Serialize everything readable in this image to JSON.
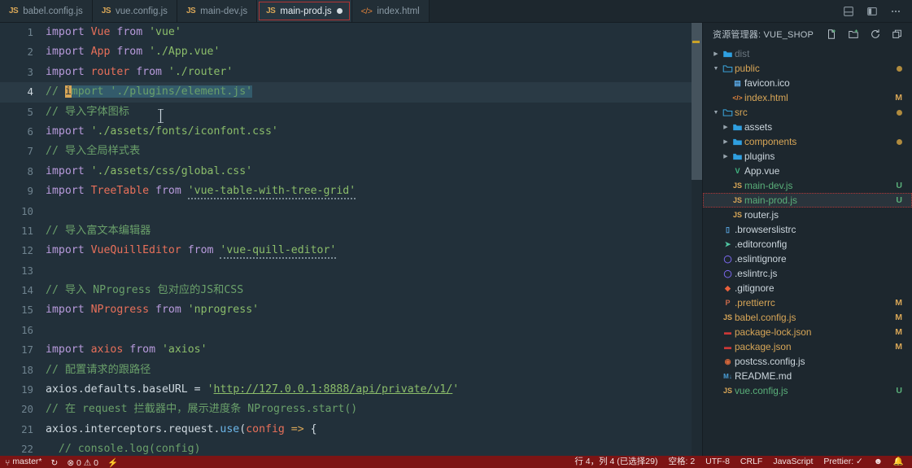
{
  "window": {
    "title": "main-prod.js — vue_shop — Visual Studio Code"
  },
  "tabbar": {
    "tabs": [
      {
        "label": "babel.config.js",
        "icon": "js-file-icon",
        "icon_text": "JS",
        "active": false,
        "dirty": false
      },
      {
        "label": "vue.config.js",
        "icon": "js-file-icon",
        "icon_text": "JS",
        "active": false,
        "dirty": false
      },
      {
        "label": "main-dev.js",
        "icon": "js-file-icon",
        "icon_text": "JS",
        "active": false,
        "dirty": false
      },
      {
        "label": "main-prod.js",
        "icon": "js-file-icon",
        "icon_text": "JS",
        "active": true,
        "dirty": true
      },
      {
        "label": "index.html",
        "icon": "html-file-icon",
        "icon_text": "</>",
        "active": false,
        "dirty": false
      }
    ],
    "actions": [
      {
        "name": "split-editor-down-icon",
        "glyph": "⫟"
      },
      {
        "name": "split-editor-right-icon",
        "glyph": "▥"
      },
      {
        "name": "more-actions-icon",
        "glyph": "···"
      }
    ]
  },
  "editor": {
    "language": "JavaScript",
    "active_line": 4,
    "lines": [
      {
        "n": 1,
        "tokens": [
          {
            "t": "import",
            "c": "kw"
          },
          {
            "t": " ",
            "c": "plain"
          },
          {
            "t": "Vue",
            "c": "id"
          },
          {
            "t": " ",
            "c": "plain"
          },
          {
            "t": "from",
            "c": "kw"
          },
          {
            "t": " ",
            "c": "plain"
          },
          {
            "t": "'vue'",
            "c": "str"
          }
        ]
      },
      {
        "n": 2,
        "tokens": [
          {
            "t": "import",
            "c": "kw"
          },
          {
            "t": " ",
            "c": "plain"
          },
          {
            "t": "App",
            "c": "id"
          },
          {
            "t": " ",
            "c": "plain"
          },
          {
            "t": "from",
            "c": "kw"
          },
          {
            "t": " ",
            "c": "plain"
          },
          {
            "t": "'./App.vue'",
            "c": "str"
          }
        ]
      },
      {
        "n": 3,
        "tokens": [
          {
            "t": "import",
            "c": "kw"
          },
          {
            "t": " ",
            "c": "plain"
          },
          {
            "t": "router",
            "c": "id"
          },
          {
            "t": " ",
            "c": "plain"
          },
          {
            "t": "from",
            "c": "kw"
          },
          {
            "t": " ",
            "c": "plain"
          },
          {
            "t": "'./router'",
            "c": "str"
          }
        ]
      },
      {
        "n": 4,
        "tokens": [
          {
            "t": "// ",
            "c": "cmt"
          },
          {
            "t": "i",
            "c": "cursor"
          },
          {
            "t": "mport './plugins/element.js'",
            "c": "cmt sel"
          }
        ]
      },
      {
        "n": 5,
        "tokens": [
          {
            "t": "// 导入字体图标",
            "c": "cmt"
          }
        ]
      },
      {
        "n": 6,
        "tokens": [
          {
            "t": "import",
            "c": "kw"
          },
          {
            "t": " ",
            "c": "plain"
          },
          {
            "t": "'./assets/fonts/iconfont.css'",
            "c": "str"
          }
        ]
      },
      {
        "n": 7,
        "tokens": [
          {
            "t": "// 导入全局样式表",
            "c": "cmt"
          }
        ]
      },
      {
        "n": 8,
        "tokens": [
          {
            "t": "import",
            "c": "kw"
          },
          {
            "t": " ",
            "c": "plain"
          },
          {
            "t": "'./assets/css/global.css'",
            "c": "str"
          }
        ]
      },
      {
        "n": 9,
        "tokens": [
          {
            "t": "import",
            "c": "kw"
          },
          {
            "t": " ",
            "c": "plain"
          },
          {
            "t": "TreeTable",
            "c": "id"
          },
          {
            "t": " ",
            "c": "plain"
          },
          {
            "t": "from",
            "c": "kw"
          },
          {
            "t": " ",
            "c": "plain"
          },
          {
            "t": "'vue-table-with-tree-grid'",
            "c": "str squiggle"
          }
        ]
      },
      {
        "n": 10,
        "tokens": []
      },
      {
        "n": 11,
        "tokens": [
          {
            "t": "// 导入富文本编辑器",
            "c": "cmt"
          }
        ]
      },
      {
        "n": 12,
        "tokens": [
          {
            "t": "import",
            "c": "kw"
          },
          {
            "t": " ",
            "c": "plain"
          },
          {
            "t": "VueQuillEditor",
            "c": "id"
          },
          {
            "t": " ",
            "c": "plain"
          },
          {
            "t": "from",
            "c": "kw"
          },
          {
            "t": " ",
            "c": "plain"
          },
          {
            "t": "'vue-quill-editor'",
            "c": "str squiggle"
          }
        ]
      },
      {
        "n": 13,
        "tokens": []
      },
      {
        "n": 14,
        "tokens": [
          {
            "t": "// 导入 NProgress 包对应的JS和CSS",
            "c": "cmt"
          }
        ]
      },
      {
        "n": 15,
        "tokens": [
          {
            "t": "import",
            "c": "kw"
          },
          {
            "t": " ",
            "c": "plain"
          },
          {
            "t": "NProgress",
            "c": "id"
          },
          {
            "t": " ",
            "c": "plain"
          },
          {
            "t": "from",
            "c": "kw"
          },
          {
            "t": " ",
            "c": "plain"
          },
          {
            "t": "'nprogress'",
            "c": "str"
          }
        ]
      },
      {
        "n": 16,
        "tokens": []
      },
      {
        "n": 17,
        "tokens": [
          {
            "t": "import",
            "c": "kw"
          },
          {
            "t": " ",
            "c": "plain"
          },
          {
            "t": "axios",
            "c": "id"
          },
          {
            "t": " ",
            "c": "plain"
          },
          {
            "t": "from",
            "c": "kw"
          },
          {
            "t": " ",
            "c": "plain"
          },
          {
            "t": "'axios'",
            "c": "str"
          }
        ]
      },
      {
        "n": 18,
        "tokens": [
          {
            "t": "// 配置请求的跟路径",
            "c": "cmt"
          }
        ]
      },
      {
        "n": 19,
        "tokens": [
          {
            "t": "axios",
            "c": "plain"
          },
          {
            "t": ".",
            "c": "punct"
          },
          {
            "t": "defaults",
            "c": "plain"
          },
          {
            "t": ".",
            "c": "punct"
          },
          {
            "t": "baseURL",
            "c": "plain"
          },
          {
            "t": " ",
            "c": "plain"
          },
          {
            "t": "=",
            "c": "op"
          },
          {
            "t": " ",
            "c": "plain"
          },
          {
            "t": "'",
            "c": "str"
          },
          {
            "t": "http://127.0.0.1:8888/api/private/v1/",
            "c": "url"
          },
          {
            "t": "'",
            "c": "str"
          }
        ]
      },
      {
        "n": 20,
        "tokens": [
          {
            "t": "// 在 request 拦截器中，展示进度条 NProgress.start()",
            "c": "cmt"
          }
        ]
      },
      {
        "n": 21,
        "tokens": [
          {
            "t": "axios",
            "c": "plain"
          },
          {
            "t": ".",
            "c": "punct"
          },
          {
            "t": "interceptors",
            "c": "plain"
          },
          {
            "t": ".",
            "c": "punct"
          },
          {
            "t": "request",
            "c": "plain"
          },
          {
            "t": ".",
            "c": "punct"
          },
          {
            "t": "use",
            "c": "fn"
          },
          {
            "t": "(",
            "c": "punct"
          },
          {
            "t": "config",
            "c": "id"
          },
          {
            "t": " ",
            "c": "plain"
          },
          {
            "t": "=>",
            "c": "arrow"
          },
          {
            "t": " ",
            "c": "plain"
          },
          {
            "t": "{",
            "c": "punct"
          }
        ]
      },
      {
        "n": 22,
        "tokens": [
          {
            "t": "  // console.log(config)",
            "c": "cmt"
          }
        ]
      }
    ]
  },
  "explorer": {
    "title": "资源管理器: VUE_SHOP",
    "actions": [
      {
        "name": "new-file-icon",
        "label": "新建文件"
      },
      {
        "name": "new-folder-icon",
        "label": "新建文件夹"
      },
      {
        "name": "refresh-explorer-icon",
        "label": "刷新"
      },
      {
        "name": "collapse-all-icon",
        "label": "在资源管理器中折叠文件夹"
      }
    ],
    "tree": [
      {
        "name": "dist",
        "type": "folder",
        "indent": 0,
        "expanded": false,
        "color": "c-grey",
        "icon": "folder-icon",
        "icon_text": "",
        "badge": ""
      },
      {
        "name": "public",
        "type": "folder",
        "indent": 0,
        "expanded": true,
        "color": "c-mod",
        "icon": "folder-open-icon",
        "icon_text": "",
        "badge": "dot"
      },
      {
        "name": "favicon.ico",
        "type": "file",
        "indent": 1,
        "color": "c-white",
        "icon": "image-file-icon",
        "icon_text": "▤",
        "badge": ""
      },
      {
        "name": "index.html",
        "type": "file",
        "indent": 1,
        "color": "c-mod",
        "icon": "html-file-icon",
        "icon_text": "</>",
        "badge": "M"
      },
      {
        "name": "src",
        "type": "folder",
        "indent": 0,
        "expanded": true,
        "color": "c-mod",
        "icon": "folder-open-icon",
        "icon_text": "",
        "badge": "dot"
      },
      {
        "name": "assets",
        "type": "folder",
        "indent": 1,
        "expanded": false,
        "color": "c-white",
        "icon": "folder-icon",
        "icon_text": "",
        "badge": ""
      },
      {
        "name": "components",
        "type": "folder",
        "indent": 1,
        "expanded": false,
        "color": "c-mod",
        "icon": "folder-icon",
        "icon_text": "",
        "badge": "dot"
      },
      {
        "name": "plugins",
        "type": "folder",
        "indent": 1,
        "expanded": false,
        "color": "c-white",
        "icon": "folder-icon",
        "icon_text": "",
        "badge": ""
      },
      {
        "name": "App.vue",
        "type": "file",
        "indent": 1,
        "color": "c-white",
        "icon": "vue-file-icon",
        "icon_text": "V",
        "badge": ""
      },
      {
        "name": "main-dev.js",
        "type": "file",
        "indent": 1,
        "color": "c-untr",
        "icon": "js-file-icon",
        "icon_text": "JS",
        "badge": "U"
      },
      {
        "name": "main-prod.js",
        "type": "file",
        "indent": 1,
        "color": "c-untr",
        "icon": "js-file-icon",
        "icon_text": "JS",
        "badge": "U",
        "selected": true
      },
      {
        "name": "router.js",
        "type": "file",
        "indent": 1,
        "color": "c-white",
        "icon": "js-file-icon",
        "icon_text": "JS",
        "badge": ""
      },
      {
        "name": ".browserslistrc",
        "type": "file",
        "indent": 0,
        "color": "c-white",
        "icon": "text-file-icon",
        "icon_text": "▯",
        "badge": ""
      },
      {
        "name": ".editorconfig",
        "type": "file",
        "indent": 0,
        "color": "c-white",
        "icon": "editorconfig-file-icon",
        "icon_text": "➤",
        "badge": ""
      },
      {
        "name": ".eslintignore",
        "type": "file",
        "indent": 0,
        "color": "c-white",
        "icon": "eslint-file-icon",
        "icon_text": "◯",
        "badge": ""
      },
      {
        "name": ".eslintrc.js",
        "type": "file",
        "indent": 0,
        "color": "c-white",
        "icon": "eslint-file-icon",
        "icon_text": "◯",
        "badge": ""
      },
      {
        "name": ".gitignore",
        "type": "file",
        "indent": 0,
        "color": "c-white",
        "icon": "git-file-icon",
        "icon_text": "◆",
        "badge": ""
      },
      {
        "name": ".prettierrc",
        "type": "file",
        "indent": 0,
        "color": "c-mod",
        "icon": "prettier-file-icon",
        "icon_text": "P",
        "badge": "M"
      },
      {
        "name": "babel.config.js",
        "type": "file",
        "indent": 0,
        "color": "c-mod",
        "icon": "js-file-icon",
        "icon_text": "JS",
        "badge": "M"
      },
      {
        "name": "package-lock.json",
        "type": "file",
        "indent": 0,
        "color": "c-mod",
        "icon": "npm-file-icon",
        "icon_text": "▬",
        "badge": "M"
      },
      {
        "name": "package.json",
        "type": "file",
        "indent": 0,
        "color": "c-mod",
        "icon": "npm-file-icon",
        "icon_text": "▬",
        "badge": "M"
      },
      {
        "name": "postcss.config.js",
        "type": "file",
        "indent": 0,
        "color": "c-white",
        "icon": "postcss-file-icon",
        "icon_text": "◉",
        "badge": ""
      },
      {
        "name": "README.md",
        "type": "file",
        "indent": 0,
        "color": "c-white",
        "icon": "markdown-file-icon",
        "icon_text": "M↓",
        "badge": ""
      },
      {
        "name": "vue.config.js",
        "type": "file",
        "indent": 0,
        "color": "c-untr",
        "icon": "js-file-icon",
        "icon_text": "JS",
        "badge": "U"
      }
    ]
  },
  "statusbar": {
    "background": "#7c1414",
    "left": [
      {
        "name": "git-branch-status",
        "icon": "source-control-icon",
        "glyph": "⑂",
        "label": "master*"
      },
      {
        "name": "sync-status",
        "icon": "sync-icon",
        "glyph": "↻",
        "label": ""
      },
      {
        "name": "problems-status",
        "icon": "error-warning-icon",
        "glyph": "⊗ 0  ⚠ 0",
        "label": ""
      },
      {
        "name": "ports-status",
        "icon": "radio-tower-icon",
        "glyph": "⚡",
        "label": ""
      }
    ],
    "right": [
      {
        "name": "cursor-position-status",
        "label": "行 4，列 4 (已选择29)"
      },
      {
        "name": "indentation-status",
        "label": "空格: 2"
      },
      {
        "name": "encoding-status",
        "label": "UTF-8"
      },
      {
        "name": "eol-status",
        "label": "CRLF"
      },
      {
        "name": "language-mode-status",
        "label": "JavaScript"
      },
      {
        "name": "prettier-status",
        "label": "Prettier: ✓"
      },
      {
        "name": "feedback-smiley-status",
        "label": "☻"
      },
      {
        "name": "notifications-status",
        "label": "🔔"
      }
    ]
  }
}
